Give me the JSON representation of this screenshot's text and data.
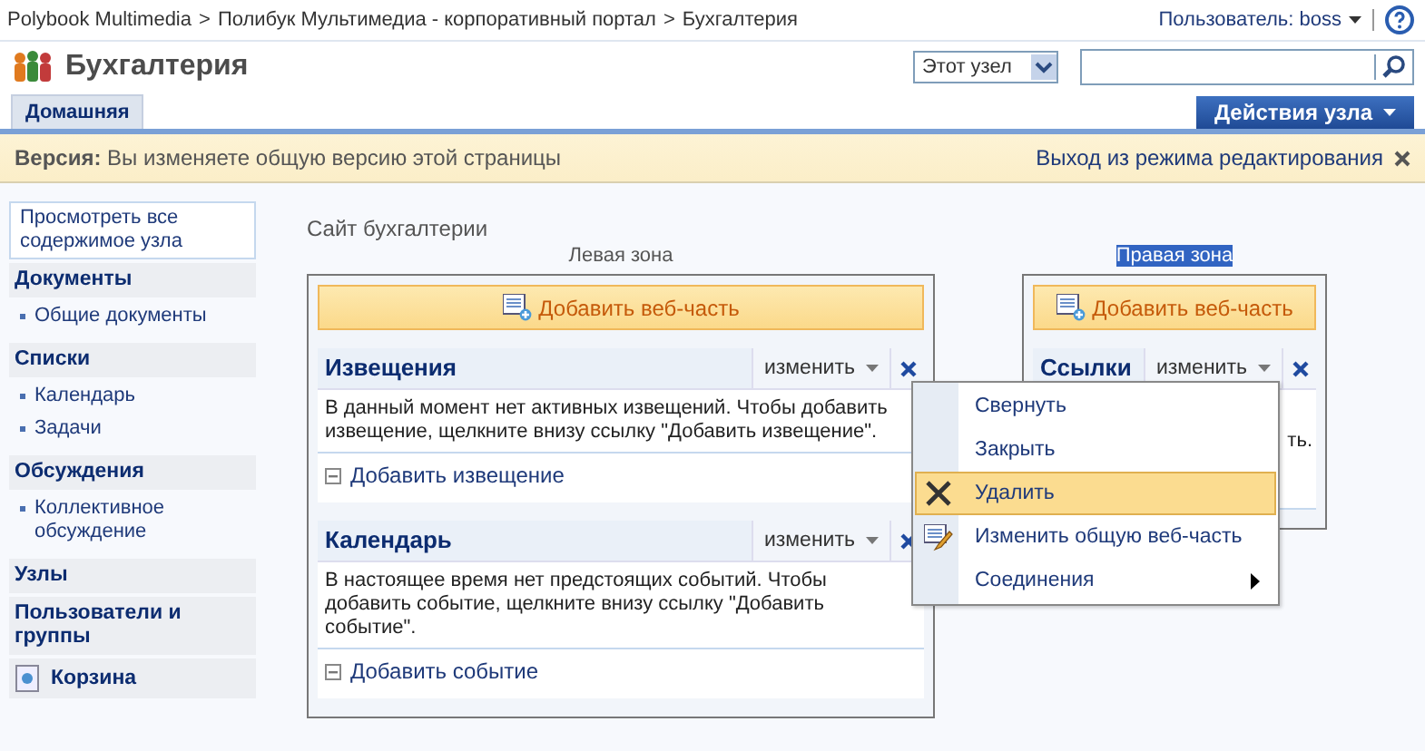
{
  "breadcrumb": {
    "separator": ">",
    "items": [
      "Polybook Multimedia",
      "Полибук Мультимедиа - корпоративный портал",
      "Бухгалтерия"
    ]
  },
  "user": {
    "label": "Пользователь: boss"
  },
  "site_title": "Бухгалтерия",
  "scope": {
    "value": "Этот узел"
  },
  "tabs": [
    {
      "label": "Домашняя",
      "selected": true
    }
  ],
  "site_actions": "Действия узла",
  "version_bar": {
    "label": "Версия:",
    "text": "Вы изменяете общую версию этой страницы",
    "exit": "Выход из режима редактирования"
  },
  "sidebar": {
    "view_all": "Просмотреть все содержимое узла",
    "sections": [
      {
        "title": "Документы",
        "kind": "header",
        "items": [
          "Общие документы"
        ]
      },
      {
        "title": "Списки",
        "kind": "header",
        "items": [
          "Календарь",
          "Задачи"
        ]
      },
      {
        "title": "Обсуждения",
        "kind": "header",
        "items": [
          "Коллективное обсуждение"
        ]
      },
      {
        "title": "Узлы",
        "kind": "header"
      },
      {
        "title": "Пользователи и группы",
        "kind": "header"
      },
      {
        "title": "Корзина",
        "kind": "recycle"
      }
    ]
  },
  "page_title": "Сайт бухгалтерии",
  "zones": [
    {
      "label": "Левая зона",
      "selected": false,
      "add_button": "Добавить веб-часть",
      "parts": [
        {
          "title": "Извещения",
          "edit": "изменить",
          "body": "В данный момент нет активных извещений. Чтобы добавить извещение, щелкните внизу ссылку \"Добавить извещение\".",
          "link": "Добавить извещение"
        },
        {
          "title": "Календарь",
          "edit": "изменить",
          "body": "В настоящее время нет предстоящих событий. Чтобы добавить событие, щелкните внизу ссылку \"Добавить событие\".",
          "link": "Добавить событие"
        }
      ]
    },
    {
      "label": "Правая зона",
      "selected": true,
      "add_button": "Добавить веб-часть",
      "parts": [
        {
          "title": "Ссылки",
          "edit": "изменить",
          "body": "ть."
        }
      ]
    }
  ],
  "menu": [
    {
      "label": "Свернуть",
      "kind": "plain",
      "hovered": false
    },
    {
      "label": "Закрыть",
      "kind": "plain",
      "hovered": false
    },
    {
      "label": "Удалить",
      "kind": "delete",
      "hovered": true
    },
    {
      "label": "Изменить общую веб-часть",
      "kind": "edit",
      "hovered": false
    },
    {
      "label": "Соединения",
      "kind": "submenu",
      "hovered": false
    }
  ]
}
